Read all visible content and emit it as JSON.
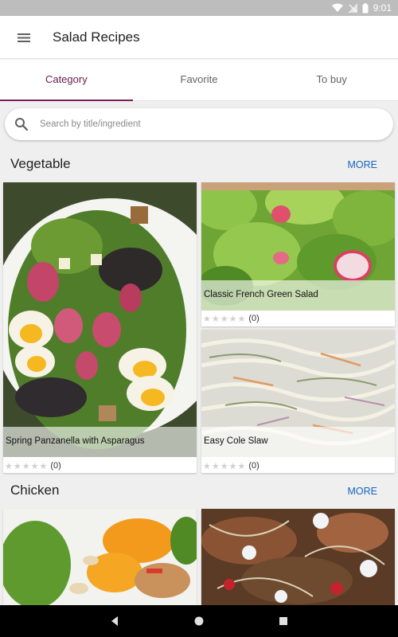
{
  "status_bar": {
    "time": "9:01"
  },
  "app_bar": {
    "title": "Salad Recipes"
  },
  "tabs": [
    {
      "label": "Category",
      "active": true
    },
    {
      "label": "Favorite",
      "active": false
    },
    {
      "label": "To buy",
      "active": false
    }
  ],
  "search": {
    "placeholder": "Search by title/ingredient"
  },
  "sections": [
    {
      "title": "Vegetable",
      "more_label": "MORE",
      "recipes": [
        {
          "title": "Spring Panzanella with Asparagus",
          "rating_count": "(0)"
        },
        {
          "title": "Classic French Green Salad",
          "rating_count": "(0)"
        },
        {
          "title": "Easy Cole Slaw",
          "rating_count": "(0)"
        }
      ]
    },
    {
      "title": "Chicken",
      "more_label": "MORE"
    }
  ],
  "colors": {
    "accent": "#7b1e57",
    "link": "#1565c0",
    "status_bar": "#bdbdbd"
  }
}
